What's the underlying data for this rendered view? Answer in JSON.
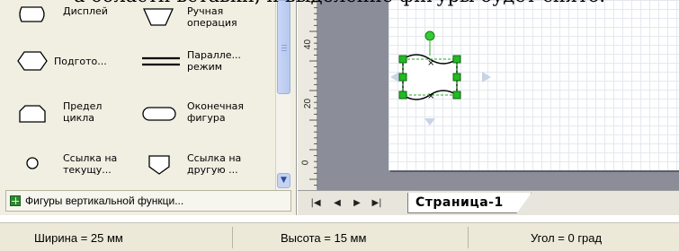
{
  "caption": "а области вставки, и выделение фигуры будет снято.",
  "shapes_panel": {
    "items": [
      {
        "label": "Дисплей",
        "icon": "display-shape-icon"
      },
      {
        "label": "Ручная\nоперация",
        "icon": "manual-operation-shape-icon"
      },
      {
        "label": "Подгото...",
        "icon": "preparation-shape-icon"
      },
      {
        "label": "Паралле...\nрежим",
        "icon": "parallel-mode-shape-icon"
      },
      {
        "label": "Предел\nцикла",
        "icon": "loop-limit-shape-icon"
      },
      {
        "label": "Оконечная\nфигура",
        "icon": "terminator-shape-icon"
      },
      {
        "label": "Ссылка на\nтекущу...",
        "icon": "on-page-reference-shape-icon"
      },
      {
        "label": "Ссылка на\nдругую ...",
        "icon": "off-page-reference-shape-icon"
      }
    ],
    "stencil_title": "Фигуры вертикальной функци..."
  },
  "ruler": {
    "labels": [
      "40",
      "20",
      "0"
    ]
  },
  "page_tabs": {
    "active_tab": "Страница-1"
  },
  "status_bar": {
    "width": "Ширина = 25 мм",
    "height": "Высота = 15 мм",
    "angle": "Угол = 0 град"
  },
  "colors": {
    "selection_handle": "#22aa22",
    "rotation_handle": "#33cc33",
    "workspace": "#8b8e99",
    "panel_bg": "#f1efe2"
  }
}
